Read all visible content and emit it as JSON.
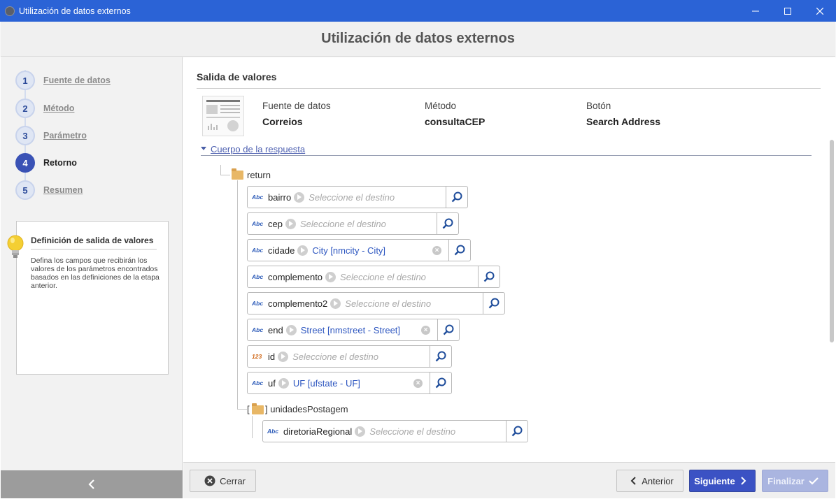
{
  "window": {
    "title": "Utilización de datos externos",
    "controls": [
      "minimize",
      "maximize",
      "close"
    ]
  },
  "header": {
    "title": "Utilización de datos externos"
  },
  "steps": [
    {
      "num": "1",
      "label": "Fuente de datos",
      "active": false
    },
    {
      "num": "2",
      "label": "Método",
      "active": false
    },
    {
      "num": "3",
      "label": "Parámetro",
      "active": false
    },
    {
      "num": "4",
      "label": "Retorno",
      "active": true
    },
    {
      "num": "5",
      "label": "Resumen",
      "active": false
    }
  ],
  "info": {
    "title": "Definición de salida de valores",
    "text": "Defina los campos que recibirán los valores de los parámetros encontrados basados en las definiciones de la etapa anterior."
  },
  "main": {
    "section_title": "Salida de valores",
    "meta": [
      {
        "key": "Fuente de datos",
        "value": "Correios"
      },
      {
        "key": "Método",
        "value": "consultaCEP"
      },
      {
        "key": "Botón",
        "value": "Search Address"
      }
    ],
    "response_label": "Cuerpo de la respuesta",
    "root": "return",
    "fields": [
      {
        "type": "Abc",
        "name": "bairro",
        "dest": "Seleccione el destino",
        "mapped": false
      },
      {
        "type": "Abc",
        "name": "cep",
        "dest": "Seleccione el destino",
        "mapped": false
      },
      {
        "type": "Abc",
        "name": "cidade",
        "dest": "City [nmcity - City]",
        "mapped": true
      },
      {
        "type": "Abc",
        "name": "complemento",
        "dest": "Seleccione el destino",
        "mapped": false
      },
      {
        "type": "Abc",
        "name": "complemento2",
        "dest": "Seleccione el destino",
        "mapped": false
      },
      {
        "type": "Abc",
        "name": "end",
        "dest": "Street [nmstreet - Street]",
        "mapped": true
      },
      {
        "type": "123",
        "name": "id",
        "dest": "Seleccione el destino",
        "mapped": false
      },
      {
        "type": "Abc",
        "name": "uf",
        "dest": "UF [ufstate - UF]",
        "mapped": true
      }
    ],
    "array_node": {
      "open": "[",
      "label": "] unidadesPostagem"
    },
    "sub_fields": [
      {
        "type": "Abc",
        "name": "diretoriaRegional",
        "dest": "Seleccione el destino",
        "mapped": false
      }
    ]
  },
  "footer": {
    "close": "Cerrar",
    "back": "Anterior",
    "next": "Siguiente",
    "finish": "Finalizar"
  },
  "colors": {
    "titlebar": "#2b63d6",
    "primary": "#3b52c4",
    "accent_text": "#2d56c0"
  }
}
